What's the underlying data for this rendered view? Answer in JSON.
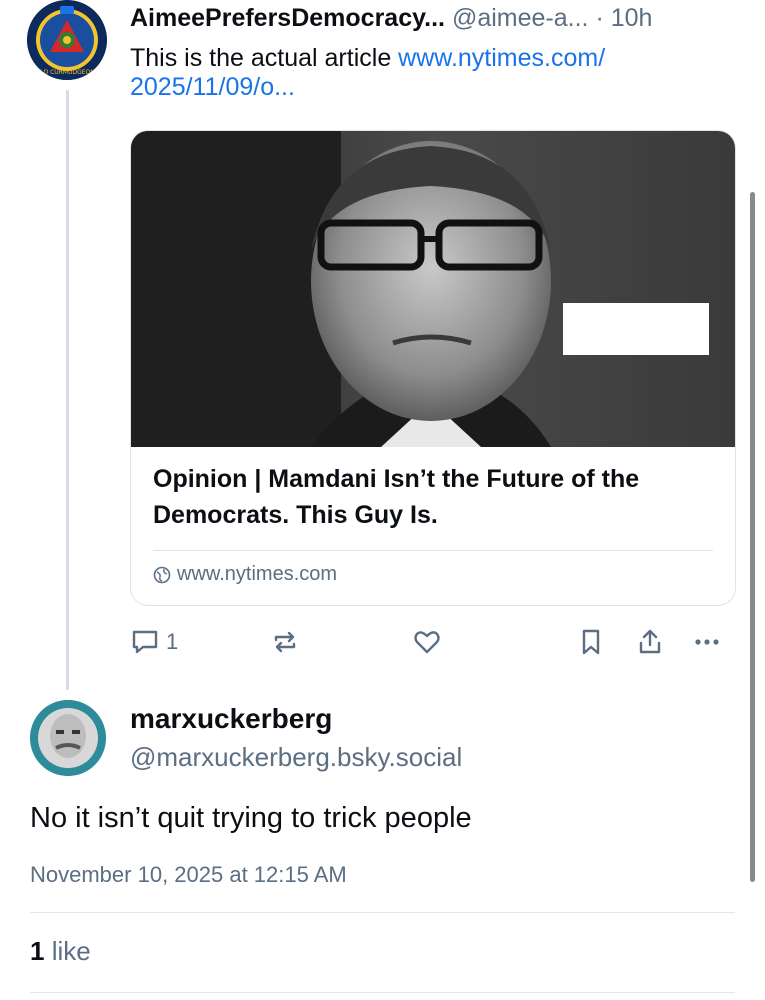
{
  "post": {
    "author_name": "AimeePrefersDemocracy...",
    "author_handle": "@aimee-a...",
    "time": "· 10h",
    "text": "This is the actual article ",
    "link_text": "www.nytimes.com/ 2025/11/09/o...",
    "avatar_badge_text": "NAFO OFAN · OLD CURMUDGEONS · RESPONSE BRIGADE"
  },
  "card": {
    "title": "Opinion | Mamdani Isn’t the Future of the Democrats. This Guy Is.",
    "domain": "www.nytimes.com"
  },
  "actions": {
    "reply_count": "1",
    "icons": [
      "reply-icon",
      "repost-icon",
      "like-icon",
      "bookmark-icon",
      "share-icon",
      "more-icon"
    ]
  },
  "reply": {
    "name": "marxuckerberg",
    "handle": "@marxuckerberg.bsky.social",
    "text": "No it isn’t quit trying to trick people",
    "timestamp": "November 10, 2025 at 12:15 AM",
    "likes_count": "1",
    "likes_label": " like"
  },
  "colors": {
    "link": "#1a73e8",
    "muted": "#5b6e82",
    "text": "#0b0f14"
  }
}
